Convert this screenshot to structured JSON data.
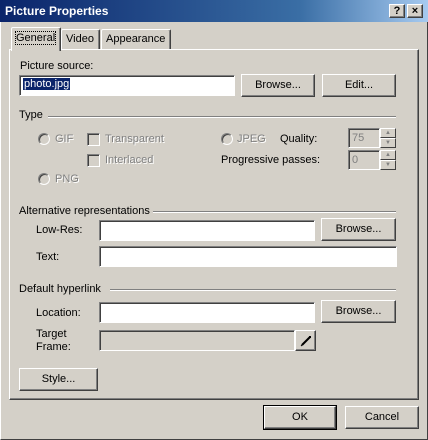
{
  "window": {
    "title": "Picture Properties",
    "help_label": "?",
    "close_label": "×"
  },
  "tabs": [
    {
      "label": "General",
      "active": true
    },
    {
      "label": "Video",
      "active": false
    },
    {
      "label": "Appearance",
      "active": false
    }
  ],
  "source": {
    "label": "Picture source:",
    "value": "photo.jpg",
    "browse_label": "Browse...",
    "edit_label": "Edit..."
  },
  "type": {
    "group_label": "Type",
    "gif_label": "GIF",
    "transparent_label": "Transparent",
    "interlaced_label": "Interlaced",
    "jpeg_label": "JPEG",
    "quality_label": "Quality:",
    "quality_value": "75",
    "progressive_label": "Progressive passes:",
    "progressive_value": "0",
    "png_label": "PNG"
  },
  "alt": {
    "group_label": "Alternative representations",
    "lowres_label": "Low-Res:",
    "lowres_value": "",
    "browse_label": "Browse...",
    "text_label": "Text:",
    "text_value": ""
  },
  "hyperlink": {
    "group_label": "Default hyperlink",
    "location_label": "Location:",
    "location_value": "",
    "browse_label": "Browse...",
    "target_label_1": "Target",
    "target_label_2": "Frame:",
    "target_value": "",
    "pencil_icon": "pencil-icon"
  },
  "style_label": "Style...",
  "ok_label": "OK",
  "cancel_label": "Cancel"
}
